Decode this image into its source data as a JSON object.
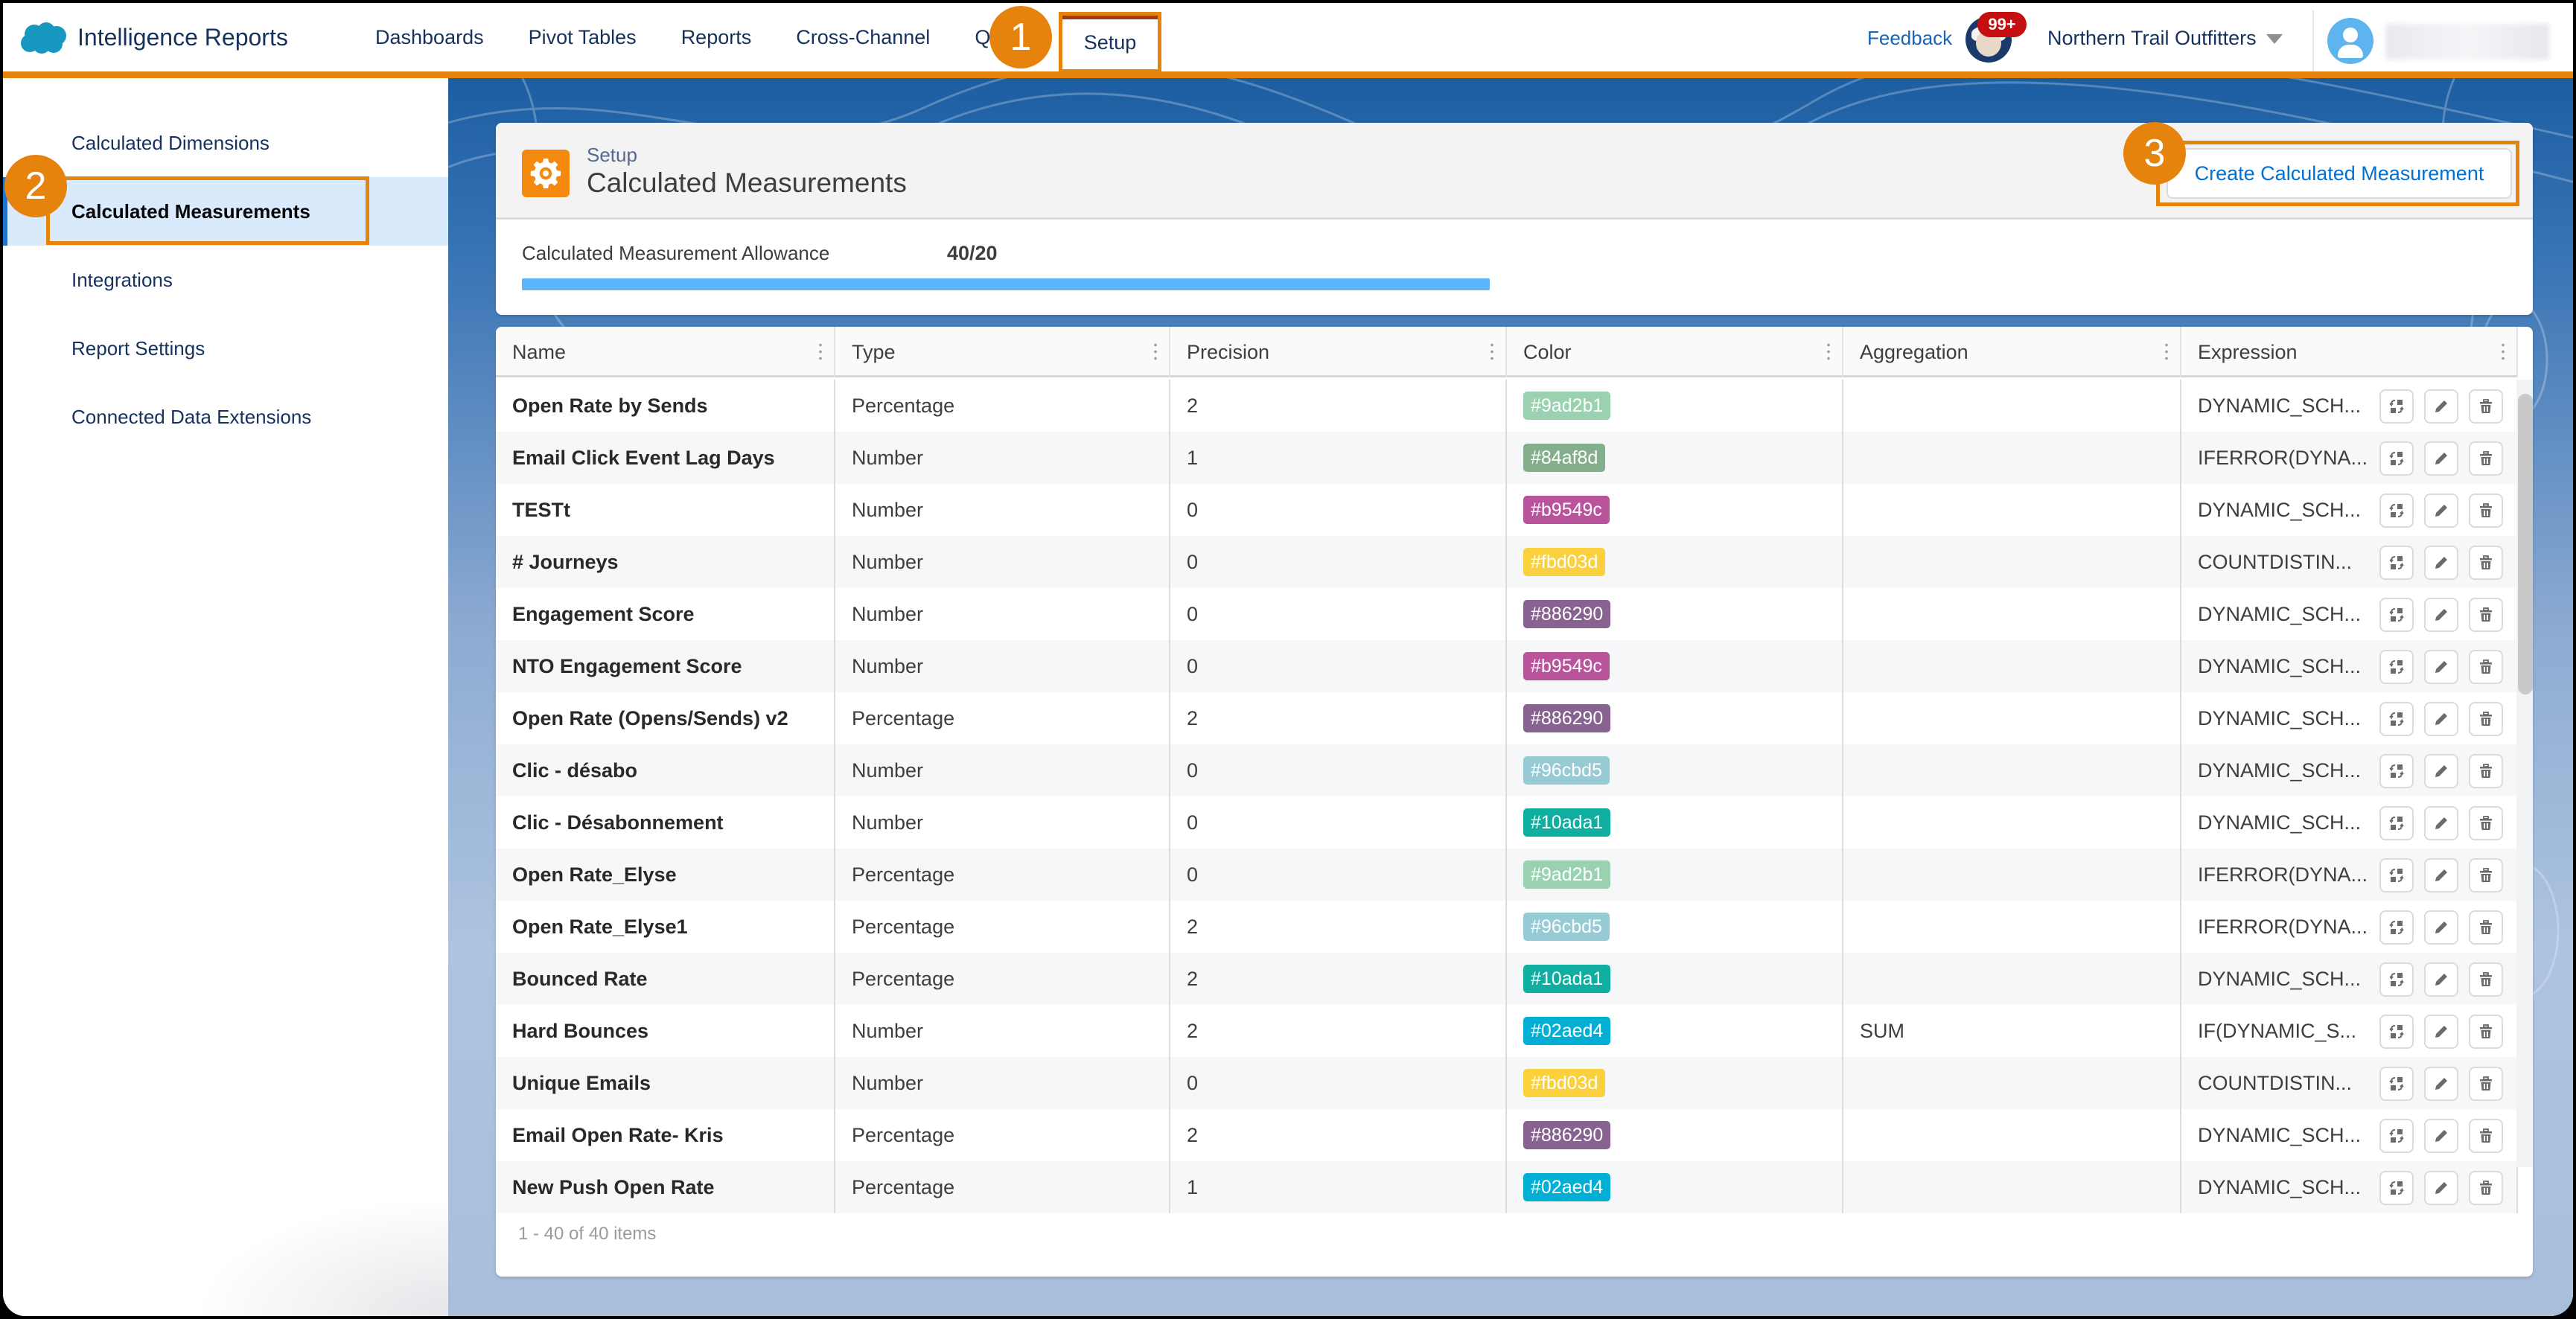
{
  "header": {
    "app_title": "Intelligence Reports",
    "nav": [
      {
        "label": "Dashboards"
      },
      {
        "label": "Pivot Tables"
      },
      {
        "label": "Reports"
      },
      {
        "label": "Cross-Channel"
      },
      {
        "label": "Qu"
      }
    ],
    "active_tab": "Setup",
    "feedback": "Feedback",
    "notification_count": "99+",
    "org_name": "Northern Trail Outfitters",
    "icons": {
      "logo": "salesforce-cloud-logo",
      "notifications": "astro-avatar-icon",
      "org_menu": "caret-down-icon",
      "user": "user-avatar-icon"
    }
  },
  "sidebar": {
    "items": [
      {
        "label": "Calculated Dimensions",
        "active": false
      },
      {
        "label": "Calculated Measurements",
        "active": true
      },
      {
        "label": "Integrations",
        "active": false
      },
      {
        "label": "Report Settings",
        "active": false
      },
      {
        "label": "Connected Data Extensions",
        "active": false
      }
    ]
  },
  "page": {
    "kicker": "Setup",
    "title": "Calculated Measurements",
    "icon": "gear-icon",
    "create_button": "Create Calculated Measurement",
    "allowance_label": "Calculated Measurement Allowance",
    "allowance_value": "40/20",
    "allowance_used": 40,
    "allowance_limit": 20,
    "allowance_fill_percent": 100
  },
  "callouts": [
    "1",
    "2",
    "3"
  ],
  "table": {
    "columns": [
      "Name",
      "Type",
      "Precision",
      "Color",
      "Aggregation",
      "Expression"
    ],
    "row_actions": [
      "swap-icon",
      "edit-icon",
      "delete-icon"
    ],
    "rows": [
      {
        "name": "Open Rate by Sends",
        "type": "Percentage",
        "precision": "2",
        "color": "#9ad2b1",
        "aggregation": "",
        "expression": "DYNAMIC_SCH..."
      },
      {
        "name": "Email Click Event Lag Days",
        "type": "Number",
        "precision": "1",
        "color": "#84af8d",
        "aggregation": "",
        "expression": "IFERROR(DYNA..."
      },
      {
        "name": "TESTt",
        "type": "Number",
        "precision": "0",
        "color": "#b9549c",
        "aggregation": "",
        "expression": "DYNAMIC_SCH..."
      },
      {
        "name": "# Journeys",
        "type": "Number",
        "precision": "0",
        "color": "#fbd03d",
        "aggregation": "",
        "expression": "COUNTDISTIN..."
      },
      {
        "name": "Engagement Score",
        "type": "Number",
        "precision": "0",
        "color": "#886290",
        "aggregation": "",
        "expression": "DYNAMIC_SCH..."
      },
      {
        "name": "NTO Engagement Score",
        "type": "Number",
        "precision": "0",
        "color": "#b9549c",
        "aggregation": "",
        "expression": "DYNAMIC_SCH..."
      },
      {
        "name": "Open Rate (Opens/Sends) v2",
        "type": "Percentage",
        "precision": "2",
        "color": "#886290",
        "aggregation": "",
        "expression": "DYNAMIC_SCH..."
      },
      {
        "name": "Clic - désabo",
        "type": "Number",
        "precision": "0",
        "color": "#96cbd5",
        "aggregation": "",
        "expression": "DYNAMIC_SCH..."
      },
      {
        "name": "Clic - Désabonnement",
        "type": "Number",
        "precision": "0",
        "color": "#10ada1",
        "aggregation": "",
        "expression": "DYNAMIC_SCH..."
      },
      {
        "name": "Open Rate_Elyse",
        "type": "Percentage",
        "precision": "0",
        "color": "#9ad2b1",
        "aggregation": "",
        "expression": "IFERROR(DYNA..."
      },
      {
        "name": "Open Rate_Elyse1",
        "type": "Percentage",
        "precision": "2",
        "color": "#96cbd5",
        "aggregation": "",
        "expression": "IFERROR(DYNA..."
      },
      {
        "name": "Bounced Rate",
        "type": "Percentage",
        "precision": "2",
        "color": "#10ada1",
        "aggregation": "",
        "expression": "DYNAMIC_SCH..."
      },
      {
        "name": "Hard Bounces",
        "type": "Number",
        "precision": "2",
        "color": "#02aed4",
        "aggregation": "SUM",
        "expression": "IF(DYNAMIC_S..."
      },
      {
        "name": "Unique Emails",
        "type": "Number",
        "precision": "0",
        "color": "#fbd03d",
        "aggregation": "",
        "expression": "COUNTDISTIN..."
      },
      {
        "name": "Email Open Rate- Kris",
        "type": "Percentage",
        "precision": "2",
        "color": "#886290",
        "aggregation": "",
        "expression": "DYNAMIC_SCH..."
      },
      {
        "name": "New Push Open Rate",
        "type": "Percentage",
        "precision": "1",
        "color": "#02aed4",
        "aggregation": "",
        "expression": "DYNAMIC_SCH..."
      }
    ],
    "pager": "1 - 40 of 40 items"
  },
  "colors": {
    "accent_orange": "#e6830d",
    "brand_blue": "#1b76d3",
    "link_blue": "#0070d2",
    "progress_blue": "#5eb4f8",
    "notification_red": "#c40e10"
  }
}
